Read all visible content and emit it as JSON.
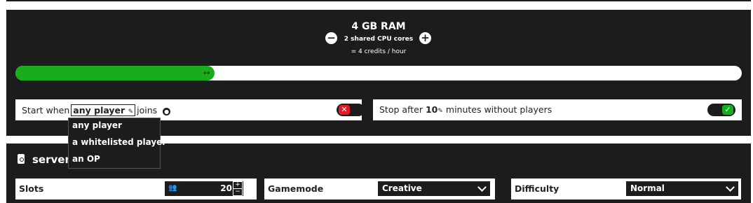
{
  "resources": {
    "ram": "4 GB RAM",
    "cpu": "2 shared CPU cores",
    "credits": "= 4 credits / hour",
    "slider_fill_fraction": 0.274,
    "decrease_symbol": "−",
    "increase_symbol": "+",
    "handle_symbol": "↔"
  },
  "autostart": {
    "prefix": "Start when",
    "selected_player": "any player",
    "suffix": "joins",
    "enabled": false,
    "toggle_symbol": "✕"
  },
  "autostop": {
    "prefix": "Stop after",
    "value": "10",
    "suffix": "minutes without players",
    "enabled": true,
    "toggle_symbol": "✓"
  },
  "player_dropdown": {
    "options": [
      "any player",
      "a whitelisted player",
      "an OP"
    ]
  },
  "properties": {
    "header_partial": "server",
    "slots": {
      "label": "Slots",
      "value": "20",
      "icon": "people-icon"
    },
    "gamemode": {
      "label": "Gamemode",
      "value": "Creative"
    },
    "difficulty": {
      "label": "Difficulty",
      "value": "Normal"
    }
  },
  "colors": {
    "panel": "#1c1c1c",
    "accent_green": "#18ad1d",
    "toggle_red": "#e01b24"
  }
}
